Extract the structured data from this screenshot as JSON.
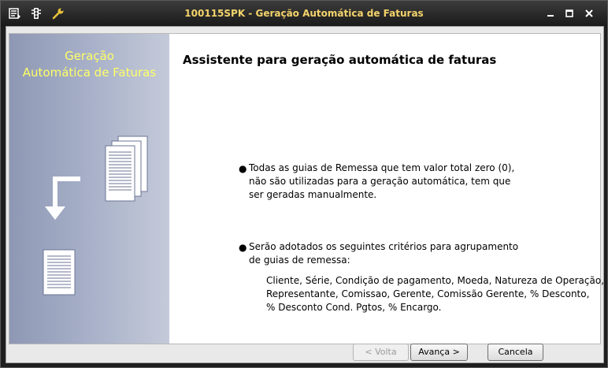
{
  "window": {
    "title": "100115SPK - Geração Automática de Faturas"
  },
  "sidebar": {
    "title_line1": "Geração",
    "title_line2": "Automática de Faturas"
  },
  "main": {
    "heading": "Assistente para geração automática de faturas",
    "bullet1": {
      "lines": [
        "Todas as guias de Remessa que tem valor total zero (0),",
        "não são utilizadas para a geração automática, tem que",
        "ser geradas manualmente."
      ]
    },
    "bullet2": {
      "lines": [
        "Serão adotados os seguintes critérios para agrupamento",
        "de guias de remessa:"
      ],
      "criteria": [
        "Cliente, Série, Condição de pagamento, Moeda, Natureza de Operação,",
        "Representante, Comissao, Gerente, Comissão Gerente, % Desconto,",
        "% Desconto Cond. Pgtos, % Encargo."
      ]
    }
  },
  "buttons": {
    "back": "< Volta",
    "next": "Avança >",
    "cancel": "Cancela"
  },
  "colors": {
    "title_text": "#f3d36b",
    "sidebar_title": "#ffff66"
  }
}
